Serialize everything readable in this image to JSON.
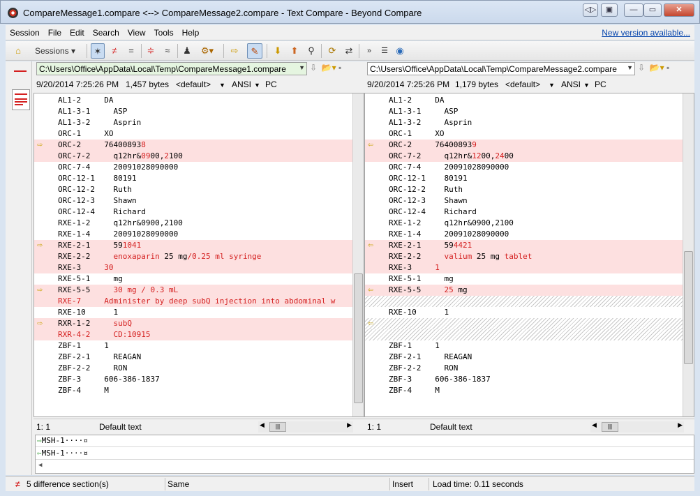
{
  "window": {
    "title": "CompareMessage1.compare <--> CompareMessage2.compare - Text Compare - Beyond Compare"
  },
  "menu": {
    "items": [
      "Session",
      "File",
      "Edit",
      "Search",
      "View",
      "Tools",
      "Help"
    ],
    "new_version": "New version available..."
  },
  "toolbar": {
    "sessions_label": "Sessions"
  },
  "left": {
    "path": "C:\\Users\\Office\\AppData\\Local\\Temp\\CompareMessage1.compare",
    "date": "9/20/2014 7:25:26 PM",
    "size": "1,457 bytes",
    "format": "<default>",
    "encoding": "ANSI",
    "lineend": "PC",
    "position": "1: 1",
    "texttype": "Default text",
    "lines": [
      {
        "k": "AL1-2",
        "v": "DA",
        "t": ""
      },
      {
        "k": "AL1-3-1",
        "v": "ASP",
        "t": ""
      },
      {
        "k": "AL1-3-2",
        "v": "Asprin",
        "t": ""
      },
      {
        "k": "ORC-1",
        "v": "XO",
        "t": ""
      },
      {
        "k": "ORC-2",
        "v": "76400893",
        "r": "8",
        "t": "diff",
        "a": true
      },
      {
        "k": "ORC-7-2",
        "v": "q12hr&",
        "r": "09",
        "v2": "00,",
        "r2": "2",
        "v3": "100",
        "t": "diff"
      },
      {
        "k": "ORC-7-4",
        "v": "20091028090000",
        "t": ""
      },
      {
        "k": "ORC-12-1",
        "v": "80191",
        "t": ""
      },
      {
        "k": "ORC-12-2",
        "v": "Ruth",
        "t": ""
      },
      {
        "k": "ORC-12-3",
        "v": "Shawn",
        "t": ""
      },
      {
        "k": "ORC-12-4",
        "v": "Richard",
        "t": ""
      },
      {
        "k": "RXE-1-2",
        "v": "q12hr&0900,2100",
        "t": ""
      },
      {
        "k": "RXE-1-4",
        "v": "20091028090000",
        "t": ""
      },
      {
        "k": "RXE-2-1",
        "v": "59",
        "r": "1041",
        "t": "diff",
        "a": true
      },
      {
        "k": "RXE-2-2",
        "v": "",
        "r": "enoxaparin",
        "v2": " 25 mg",
        "r2": "/0.25 ml syringe",
        "v3": "",
        "t": "diff"
      },
      {
        "k": "RXE-3",
        "v": "",
        "r": "30",
        "t": "diff"
      },
      {
        "k": "RXE-5-1",
        "v": "mg",
        "t": ""
      },
      {
        "k": "RXE-5-5",
        "v": "",
        "r": "30 mg / 0.3 mL",
        "t": "diff",
        "a": true
      },
      {
        "k": "RXE-7",
        "v": "",
        "r": "Administer by deep subQ injection into abdominal w",
        "t": "diff",
        "allred": true
      },
      {
        "k": "RXE-10",
        "v": "1",
        "t": ""
      },
      {
        "k": "RXR-1-2",
        "v": "",
        "r": "subQ",
        "t": "diff",
        "a": true
      },
      {
        "k": "RXR-4-2",
        "v": "",
        "r": "CD:10915",
        "t": "diff",
        "allred": true
      },
      {
        "k": "ZBF-1",
        "v": "1",
        "t": ""
      },
      {
        "k": "ZBF-2-1",
        "v": "REAGAN",
        "t": ""
      },
      {
        "k": "ZBF-2-2",
        "v": "RON",
        "t": ""
      },
      {
        "k": "ZBF-3",
        "v": "606-386-1837",
        "t": ""
      },
      {
        "k": "ZBF-4",
        "v": "M",
        "t": ""
      }
    ]
  },
  "right": {
    "path": "C:\\Users\\Office\\AppData\\Local\\Temp\\CompareMessage2.compare",
    "date": "9/20/2014 7:25:26 PM",
    "size": "1,179 bytes",
    "format": "<default>",
    "encoding": "ANSI",
    "lineend": "PC",
    "position": "1: 1",
    "texttype": "Default text",
    "lines": [
      {
        "k": "AL1-2",
        "v": "DA",
        "t": ""
      },
      {
        "k": "AL1-3-1",
        "v": "ASP",
        "t": ""
      },
      {
        "k": "AL1-3-2",
        "v": "Asprin",
        "t": ""
      },
      {
        "k": "ORC-1",
        "v": "XO",
        "t": ""
      },
      {
        "k": "ORC-2",
        "v": "76400893",
        "r": "9",
        "t": "diff",
        "a": true
      },
      {
        "k": "ORC-7-2",
        "v": "q12hr&",
        "r": "12",
        "v2": "00,",
        "r2": "24",
        "v3": "00",
        "t": "diff"
      },
      {
        "k": "ORC-7-4",
        "v": "20091028090000",
        "t": ""
      },
      {
        "k": "ORC-12-1",
        "v": "80191",
        "t": ""
      },
      {
        "k": "ORC-12-2",
        "v": "Ruth",
        "t": ""
      },
      {
        "k": "ORC-12-3",
        "v": "Shawn",
        "t": ""
      },
      {
        "k": "ORC-12-4",
        "v": "Richard",
        "t": ""
      },
      {
        "k": "RXE-1-2",
        "v": "q12hr&0900,2100",
        "t": ""
      },
      {
        "k": "RXE-1-4",
        "v": "20091028090000",
        "t": ""
      },
      {
        "k": "RXE-2-1",
        "v": "59",
        "r": "4421",
        "t": "diff",
        "a": true
      },
      {
        "k": "RXE-2-2",
        "v": "",
        "r": "valium",
        "v2": " 25 mg ",
        "r2": "tablet",
        "v3": "",
        "t": "diff"
      },
      {
        "k": "RXE-3",
        "v": "",
        "r": "1",
        "t": "diff"
      },
      {
        "k": "RXE-5-1",
        "v": "mg",
        "t": ""
      },
      {
        "k": "RXE-5-5",
        "v": "",
        "r": "25",
        "v2": " mg",
        "t": "diff",
        "a": true
      },
      {
        "k": "",
        "v": "",
        "t": "miss"
      },
      {
        "k": "RXE-10",
        "v": "1",
        "t": ""
      },
      {
        "k": "",
        "v": "",
        "t": "miss",
        "a": true
      },
      {
        "k": "",
        "v": "",
        "t": "miss"
      },
      {
        "k": "ZBF-1",
        "v": "1",
        "t": ""
      },
      {
        "k": "ZBF-2-1",
        "v": "REAGAN",
        "t": ""
      },
      {
        "k": "ZBF-2-2",
        "v": "RON",
        "t": ""
      },
      {
        "k": "ZBF-3",
        "v": "606-386-1837",
        "t": ""
      },
      {
        "k": "ZBF-4",
        "v": "M",
        "t": ""
      }
    ]
  },
  "lineview": {
    "top": "MSH-1····¤",
    "bottom": "MSH-1····¤"
  },
  "status": {
    "diffs": "5 difference section(s)",
    "same": "Same",
    "mode": "Insert",
    "loadtime": "Load time: 0.11 seconds"
  }
}
